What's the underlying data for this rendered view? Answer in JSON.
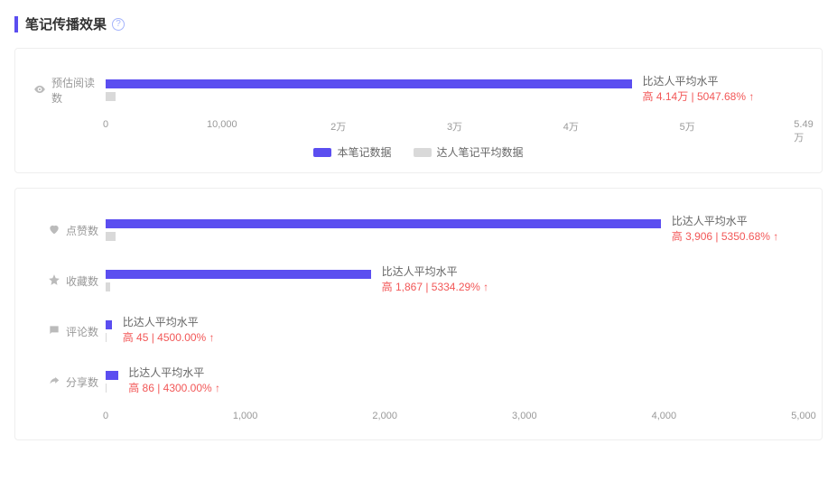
{
  "section": {
    "title": "笔记传播效果",
    "help_tooltip": "?"
  },
  "legend": {
    "primary": "本笔记数据",
    "avg": "达人笔记平均数据"
  },
  "colors": {
    "primary": "#5b4ef0",
    "avg": "#d9d9d9",
    "accent": "#f25757"
  },
  "chart1": {
    "max": 54900,
    "ticks": [
      "0",
      "10,000",
      "2万",
      "3万",
      "4万",
      "5万",
      "5.49万"
    ],
    "rows": [
      {
        "icon": "eye-icon",
        "label": "预估阅读数",
        "value": 41400,
        "avg": 800,
        "annot_title": "比达人平均水平",
        "annot_value": "高 4.14万 | 5047.68% ↑"
      }
    ]
  },
  "chart2": {
    "max": 5000,
    "ticks": [
      "0",
      "1,000",
      "2,000",
      "3,000",
      "4,000",
      "5,000"
    ],
    "rows": [
      {
        "icon": "heart-icon",
        "label": "点赞数",
        "value": 3979,
        "avg": 73,
        "annot_title": "比达人平均水平",
        "annot_value": "高 3,906 | 5350.68% ↑"
      },
      {
        "icon": "star-icon",
        "label": "收藏数",
        "value": 1902,
        "avg": 35,
        "annot_title": "比达人平均水平",
        "annot_value": "高 1,867 | 5334.29% ↑"
      },
      {
        "icon": "comment-icon",
        "label": "评论数",
        "value": 46,
        "avg": 1,
        "annot_title": "比达人平均水平",
        "annot_value": "高 45 | 4500.00% ↑"
      },
      {
        "icon": "share-icon",
        "label": "分享数",
        "value": 88,
        "avg": 2,
        "annot_title": "比达人平均水平",
        "annot_value": "高 86 | 4300.00% ↑"
      }
    ]
  },
  "chart_data": [
    {
      "type": "bar",
      "title": "预估阅读数",
      "orientation": "horizontal",
      "categories": [
        "预估阅读数"
      ],
      "series": [
        {
          "name": "本笔记数据",
          "values": [
            41400
          ]
        },
        {
          "name": "达人笔记平均数据",
          "values": [
            800
          ]
        }
      ],
      "xlim": [
        0,
        54900
      ],
      "xticks": [
        0,
        10000,
        20000,
        30000,
        40000,
        50000,
        54900
      ],
      "annotations": [
        {
          "category": "预估阅读数",
          "text": "比达人平均水平 高 4.14万 | 5047.68% ↑"
        }
      ]
    },
    {
      "type": "bar",
      "title": "互动数据",
      "orientation": "horizontal",
      "categories": [
        "点赞数",
        "收藏数",
        "评论数",
        "分享数"
      ],
      "series": [
        {
          "name": "本笔记数据",
          "values": [
            3979,
            1902,
            46,
            88
          ]
        },
        {
          "name": "达人笔记平均数据",
          "values": [
            73,
            35,
            1,
            2
          ]
        }
      ],
      "xlim": [
        0,
        5000
      ],
      "xticks": [
        0,
        1000,
        2000,
        3000,
        4000,
        5000
      ],
      "annotations": [
        {
          "category": "点赞数",
          "text": "比达人平均水平 高 3,906 | 5350.68% ↑"
        },
        {
          "category": "收藏数",
          "text": "比达人平均水平 高 1,867 | 5334.29% ↑"
        },
        {
          "category": "评论数",
          "text": "比达人平均水平 高 45 | 4500.00% ↑"
        },
        {
          "category": "分享数",
          "text": "比达人平均水平 高 86 | 4300.00% ↑"
        }
      ]
    }
  ]
}
